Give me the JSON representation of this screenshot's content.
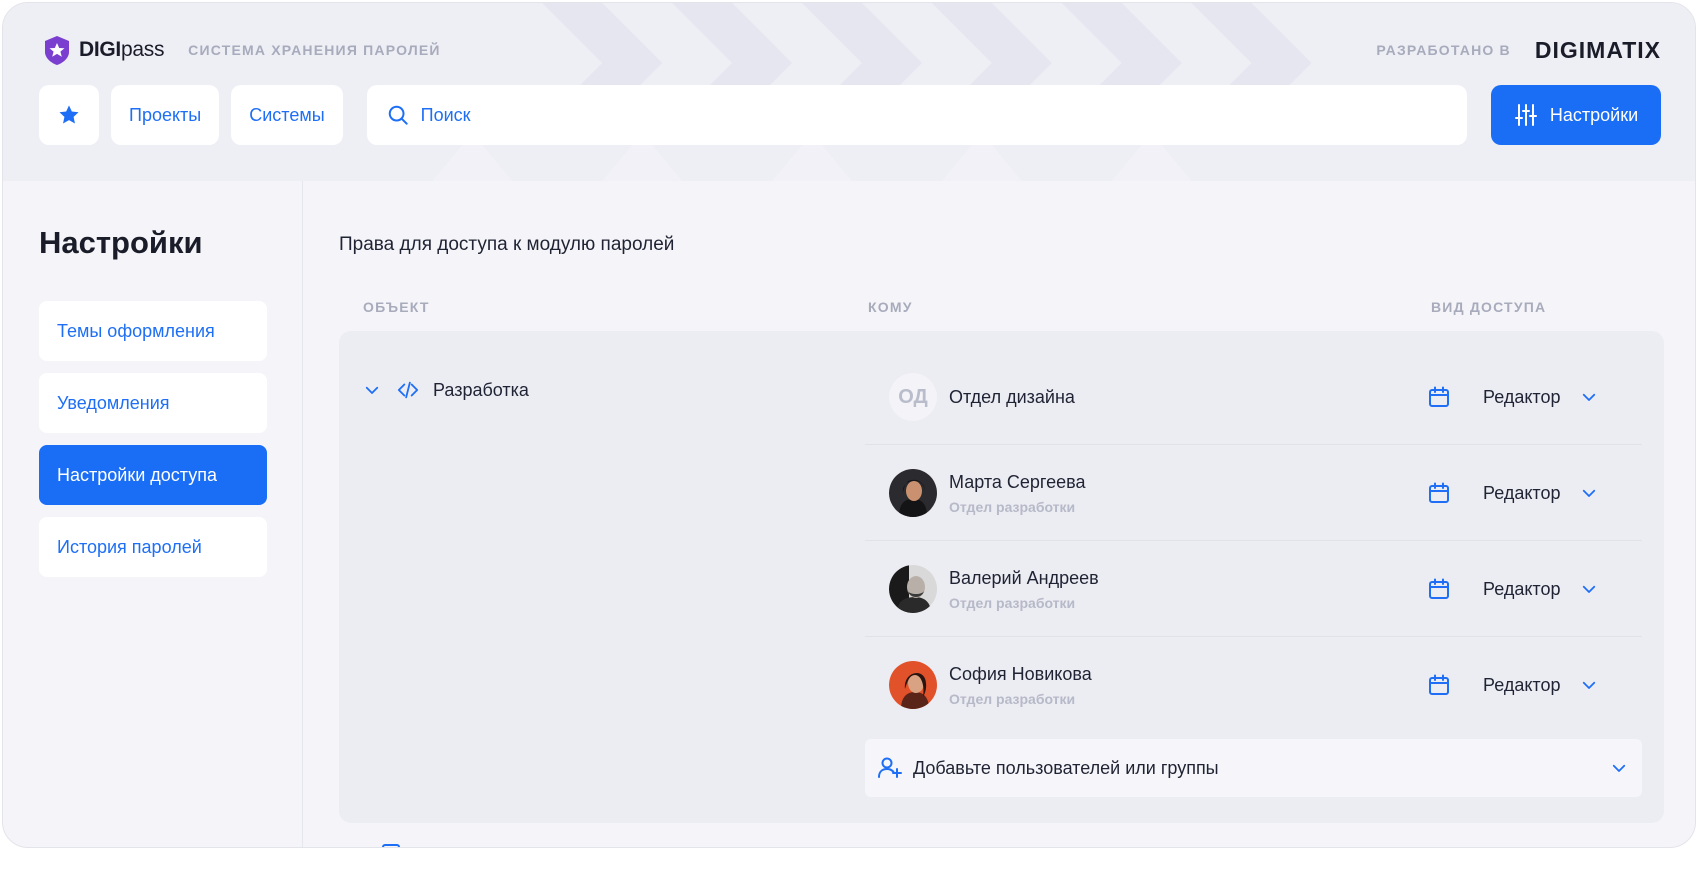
{
  "brand": {
    "name_bold": "DIGI",
    "name_light": "pass",
    "subtitle": "СИСТЕМА ХРАНЕНИЯ ПАРОЛЕЙ",
    "credit_label": "РАЗРАБОТАНО В",
    "credit_brand": "DIGIMATIX"
  },
  "toolbar": {
    "projects_label": "Проекты",
    "systems_label": "Системы",
    "search_placeholder": "Поиск",
    "settings_label": "Настройки"
  },
  "sidebar": {
    "title": "Настройки",
    "items": [
      {
        "label": "Темы оформления"
      },
      {
        "label": "Уведомления"
      },
      {
        "label": "Настройки доступа"
      },
      {
        "label": "История паролей"
      }
    ]
  },
  "main": {
    "title": "Права для доступа к модулю паролей",
    "columns": {
      "object": "ОБЪЕКТ",
      "whom": "КОМУ",
      "access": "ВИД ДОСТУПА"
    },
    "object": {
      "label": "Разработка"
    },
    "rows": [
      {
        "initials": "ОД",
        "name": "Отдел дизайна",
        "dept": "",
        "access": "Редактор"
      },
      {
        "name": "Марта Сергеева",
        "dept": "Отдел разработки",
        "access": "Редактор"
      },
      {
        "name": "Валерий Андреев",
        "dept": "Отдел разработки",
        "access": "Редактор"
      },
      {
        "name": "София Новикова",
        "dept": "Отдел разработки",
        "access": "Редактор"
      }
    ],
    "add_label": "Добавьте пользователей или группы"
  },
  "colors": {
    "accent": "#1a6ef5",
    "logo": "#7b3fd0",
    "muted": "#a7abbb"
  }
}
